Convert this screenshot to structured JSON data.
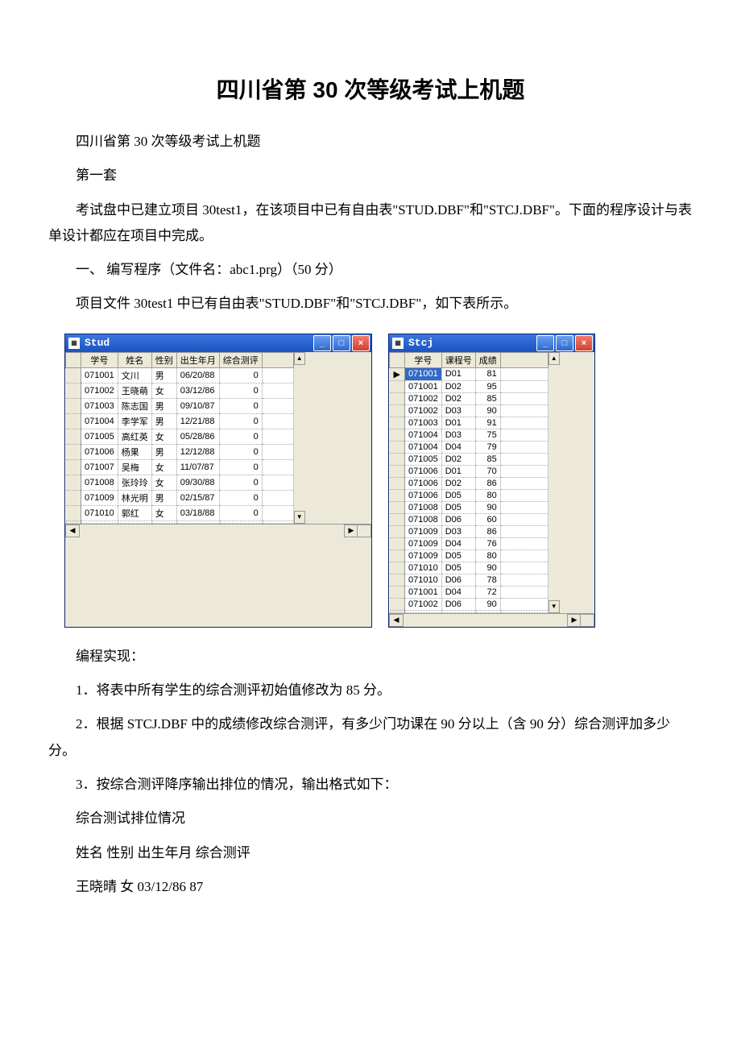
{
  "title": "四川省第 30 次等级考试上机题",
  "paras": {
    "p1": "四川省第 30 次等级考试上机题",
    "p2": "第一套",
    "p3": "考试盘中已建立项目 30test1，在该项目中已有自由表\"STUD.DBF\"和\"STCJ.DBF\"。下面的程序设计与表单设计都应在项目中完成。",
    "p4": "一、 编写程序（文件名：abc1.prg）（50 分）",
    "p5": "项目文件 30test1 中已有自由表\"STUD.DBF\"和\"STCJ.DBF\"，如下表所示。",
    "p6": "编程实现：",
    "p7": "1．将表中所有学生的综合测评初始值修改为 85 分。",
    "p8": "2．根据 STCJ.DBF 中的成绩修改综合测评，有多少门功课在 90 分以上（含 90 分）综合测评加多少分。",
    "p9": "3．按综合测评降序输出排位的情况，输出格式如下：",
    "p10": "综合测试排位情况",
    "p11": "姓名 性别 出生年月 综合测评",
    "p12": "王晓晴 女 03/12/86 87"
  },
  "stud": {
    "title": "Stud",
    "headers": [
      "",
      "学号",
      "姓名",
      "性别",
      "出生年月",
      "综合测评",
      ""
    ],
    "rows": [
      {
        "sel": " ",
        "xh": "071001",
        "xm": "文川",
        "xb": "男",
        "cs": "06/20/88",
        "zp": "0"
      },
      {
        "sel": " ",
        "xh": "071002",
        "xm": "王晓萌",
        "xb": "女",
        "cs": "03/12/86",
        "zp": "0"
      },
      {
        "sel": " ",
        "xh": "071003",
        "xm": "陈志国",
        "xb": "男",
        "cs": "09/10/87",
        "zp": "0"
      },
      {
        "sel": " ",
        "xh": "071004",
        "xm": "李学军",
        "xb": "男",
        "cs": "12/21/88",
        "zp": "0"
      },
      {
        "sel": " ",
        "xh": "071005",
        "xm": "高红英",
        "xb": "女",
        "cs": "05/28/86",
        "zp": "0"
      },
      {
        "sel": " ",
        "xh": "071006",
        "xm": "杨果",
        "xb": "男",
        "cs": "12/12/88",
        "zp": "0"
      },
      {
        "sel": " ",
        "xh": "071007",
        "xm": "吴梅",
        "xb": "女",
        "cs": "11/07/87",
        "zp": "0"
      },
      {
        "sel": " ",
        "xh": "071008",
        "xm": "张玲玲",
        "xb": "女",
        "cs": "09/30/88",
        "zp": "0"
      },
      {
        "sel": " ",
        "xh": "071009",
        "xm": "林光明",
        "xb": "男",
        "cs": "02/15/87",
        "zp": "0"
      },
      {
        "sel": " ",
        "xh": "071010",
        "xm": "郭红",
        "xb": "女",
        "cs": "03/18/88",
        "zp": "0"
      },
      {
        "sel": " ",
        "xh": "",
        "xm": "",
        "xb": "",
        "cs": "",
        "zp": ""
      }
    ]
  },
  "stcj": {
    "title": "Stcj",
    "headers": [
      "",
      "学号",
      "课程号",
      "成绩",
      ""
    ],
    "rows": [
      {
        "sel": "▶",
        "xh": "071001",
        "kc": "D01",
        "cj": "81",
        "hl": true
      },
      {
        "sel": " ",
        "xh": "071001",
        "kc": "D02",
        "cj": "95"
      },
      {
        "sel": " ",
        "xh": "071002",
        "kc": "D02",
        "cj": "85"
      },
      {
        "sel": " ",
        "xh": "071002",
        "kc": "D03",
        "cj": "90"
      },
      {
        "sel": " ",
        "xh": "071003",
        "kc": "D01",
        "cj": "91"
      },
      {
        "sel": " ",
        "xh": "071004",
        "kc": "D03",
        "cj": "75"
      },
      {
        "sel": " ",
        "xh": "071004",
        "kc": "D04",
        "cj": "79"
      },
      {
        "sel": " ",
        "xh": "071005",
        "kc": "D02",
        "cj": "85"
      },
      {
        "sel": " ",
        "xh": "071006",
        "kc": "D01",
        "cj": "70"
      },
      {
        "sel": " ",
        "xh": "071006",
        "kc": "D02",
        "cj": "86"
      },
      {
        "sel": " ",
        "xh": "071006",
        "kc": "D05",
        "cj": "80"
      },
      {
        "sel": " ",
        "xh": "071008",
        "kc": "D05",
        "cj": "90"
      },
      {
        "sel": " ",
        "xh": "071008",
        "kc": "D06",
        "cj": "60"
      },
      {
        "sel": " ",
        "xh": "071009",
        "kc": "D03",
        "cj": "86"
      },
      {
        "sel": " ",
        "xh": "071009",
        "kc": "D04",
        "cj": "76"
      },
      {
        "sel": " ",
        "xh": "071009",
        "kc": "D05",
        "cj": "80"
      },
      {
        "sel": " ",
        "xh": "071010",
        "kc": "D05",
        "cj": "90"
      },
      {
        "sel": " ",
        "xh": "071010",
        "kc": "D06",
        "cj": "78"
      },
      {
        "sel": " ",
        "xh": "071001",
        "kc": "D04",
        "cj": "72"
      },
      {
        "sel": " ",
        "xh": "071002",
        "kc": "D06",
        "cj": "90"
      },
      {
        "sel": " ",
        "xh": "",
        "kc": "",
        "cj": ""
      }
    ]
  },
  "winbtn": {
    "min": "_",
    "max": "□",
    "close": "×"
  }
}
